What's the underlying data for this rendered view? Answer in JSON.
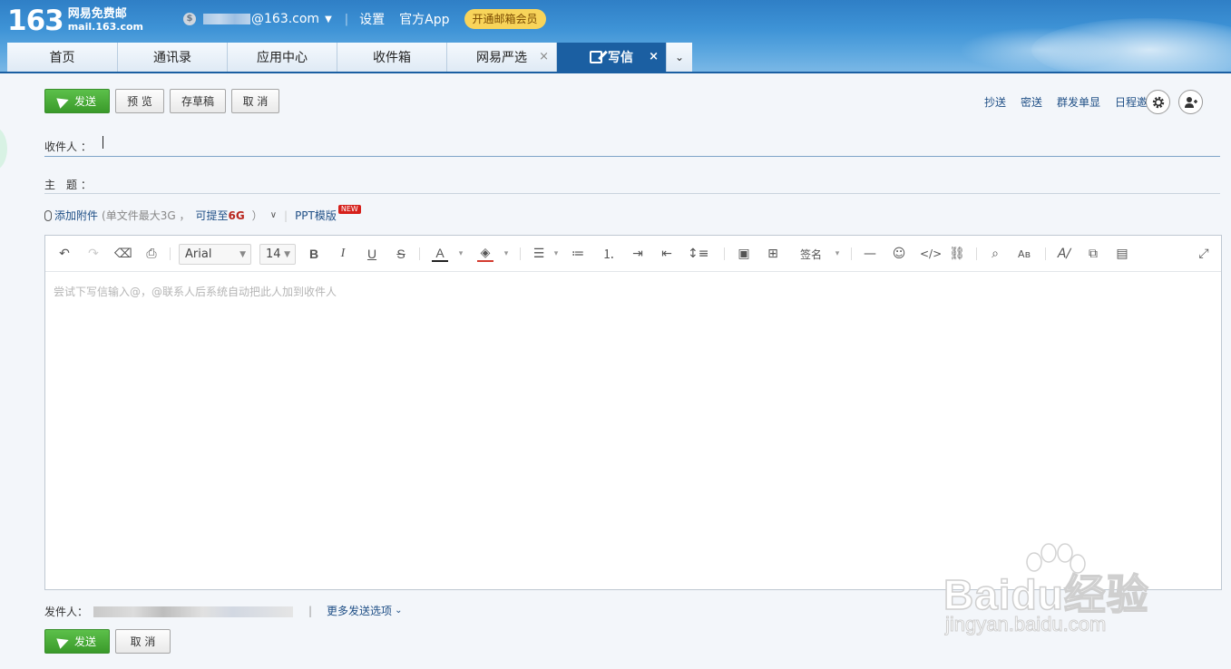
{
  "header": {
    "logo_num": "163",
    "logo_cn": "网易免费邮",
    "logo_en": "mail.163.com",
    "account_suffix": "@163.com",
    "settings": "设置",
    "app": "官方App",
    "vip": "开通邮箱会员"
  },
  "tabs": [
    {
      "label": "首页"
    },
    {
      "label": "通讯录"
    },
    {
      "label": "应用中心"
    },
    {
      "label": "收件箱"
    },
    {
      "label": "网易严选",
      "close": "×"
    },
    {
      "label": "写信",
      "close": "×"
    }
  ],
  "tabs_more": "⌄",
  "toolbar_buttons": {
    "send": "发送",
    "preview": "预 览",
    "draft": "存草稿",
    "cancel": "取 消"
  },
  "right_links": {
    "cc": "抄送",
    "bcc": "密送",
    "separate": "群发单显",
    "schedule": "日程邀请"
  },
  "fields": {
    "to_label": "收件人 ：",
    "subject_label": "主　题 ："
  },
  "attach": {
    "add": "添加附件",
    "limit_prefix": "(单文件最大3G ，",
    "upgrade_prefix": "可提至",
    "upgrade_size": "6G",
    "limit_suffix": "）",
    "ppt": "PPT模版",
    "new_badge": "NEW"
  },
  "editor": {
    "font_family": "Arial",
    "font_size": "14",
    "signature": "签名",
    "placeholder": "尝试下写信输入@，@联系人后系统自动把此人加到收件人"
  },
  "footer": {
    "sender_label": "发件人：",
    "sep": "|",
    "more_options": "更多发送选项",
    "send": "发送",
    "cancel": "取 消"
  },
  "watermark": {
    "brand": "Baidu经验",
    "domain": "jingyan.baidu.com"
  },
  "colors": {
    "header_blue": "#3e93d6",
    "active_tab": "#1b5fa2",
    "send_green": "#3a9a2a",
    "link_blue": "#1f4f86",
    "vip_yellow": "#f8d45a"
  }
}
